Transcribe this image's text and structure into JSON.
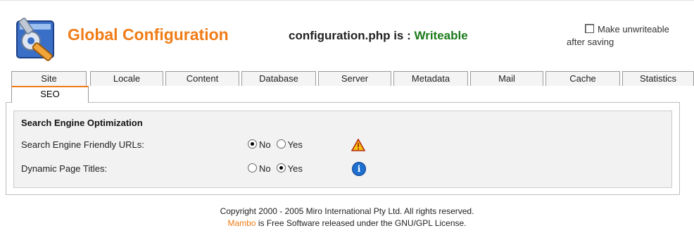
{
  "header": {
    "title": "Global Configuration",
    "file_status_prefix": "configuration.php is : ",
    "file_status_value": "Writeable",
    "unwriteable_label_line1": "Make unwriteable",
    "unwriteable_label_line2": "after saving",
    "unwriteable_checked": false
  },
  "tabs": [
    {
      "label": "Site"
    },
    {
      "label": "Locale"
    },
    {
      "label": "Content"
    },
    {
      "label": "Database"
    },
    {
      "label": "Server"
    },
    {
      "label": "Metadata"
    },
    {
      "label": "Mail"
    },
    {
      "label": "Cache"
    },
    {
      "label": "Statistics"
    }
  ],
  "active_tab": {
    "label": "SEO"
  },
  "section": {
    "title": "Search Engine Optimization",
    "rows": [
      {
        "label": "Search Engine Friendly URLs:",
        "options": [
          "No",
          "Yes"
        ],
        "selected": "No",
        "icon": "warning-icon"
      },
      {
        "label": "Dynamic Page Titles:",
        "options": [
          "No",
          "Yes"
        ],
        "selected": "Yes",
        "icon": "info-icon"
      }
    ]
  },
  "footer": {
    "line1": "Copyright 2000 - 2005 Miro International Pty Ltd. All rights reserved.",
    "line2_link": "Mambo",
    "line2_rest": " is Free Software released under the GNU/GPL License."
  },
  "colors": {
    "accent": "#f07c16",
    "writeable": "#1a7a1a",
    "info": "#1e6fd0",
    "warning": "#f4c20d"
  }
}
